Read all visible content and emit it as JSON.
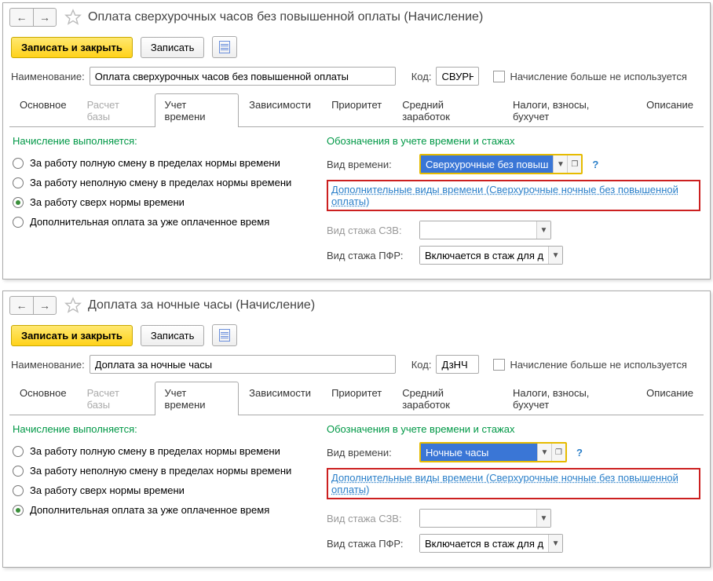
{
  "windows": [
    {
      "title": "Оплата сверхурочных часов без повышенной оплаты (Начисление)",
      "toolbar": {
        "primary": "Записать и закрыть",
        "write": "Записать"
      },
      "nameLabel": "Наименование:",
      "nameVal": "Оплата сверхурочных часов без повышенной оплаты",
      "codeLabel": "Код:",
      "codeVal": "СВУРН",
      "unusedLabel": "Начисление больше не используется",
      "tabs": {
        "main": "Основное",
        "base": "Расчет базы",
        "time": "Учет времени",
        "dep": "Зависимости",
        "prio": "Приоритет",
        "avg": "Средний заработок",
        "tax": "Налоги, взносы, бухучет",
        "desc": "Описание"
      },
      "leftHead": "Начисление выполняется:",
      "radios": {
        "r1": "За работу полную смену в пределах нормы времени",
        "r2": "За работу неполную смену в пределах нормы времени",
        "r3": "За работу сверх нормы времени",
        "r4": "Дополнительная оплата за уже оплаченное время"
      },
      "radioSel": "r3",
      "rightHead": "Обозначения в учете времени и стажах",
      "timeTypeLabel": "Вид времени:",
      "timeTypeVal": "Сверхурочные без повыш",
      "extraLink": "Дополнительные виды времени (Сверхурочные ночные без повышенной оплаты)",
      "szvLabel": "Вид стажа СЗВ:",
      "szvVal": "",
      "pfrLabel": "Вид стажа ПФР:",
      "pfrVal": "Включается в стаж для д"
    },
    {
      "title": "Доплата за ночные часы (Начисление)",
      "toolbar": {
        "primary": "Записать и закрыть",
        "write": "Записать"
      },
      "nameLabel": "Наименование:",
      "nameVal": "Доплата за ночные часы",
      "codeLabel": "Код:",
      "codeVal": "ДзНЧ",
      "unusedLabel": "Начисление больше не используется",
      "tabs": {
        "main": "Основное",
        "base": "Расчет базы",
        "time": "Учет времени",
        "dep": "Зависимости",
        "prio": "Приоритет",
        "avg": "Средний заработок",
        "tax": "Налоги, взносы, бухучет",
        "desc": "Описание"
      },
      "leftHead": "Начисление выполняется:",
      "radios": {
        "r1": "За работу полную смену в пределах нормы времени",
        "r2": "За работу неполную смену в пределах нормы времени",
        "r3": "За работу сверх нормы времени",
        "r4": "Дополнительная оплата за уже оплаченное время"
      },
      "radioSel": "r4",
      "rightHead": "Обозначения в учете времени и стажах",
      "timeTypeLabel": "Вид времени:",
      "timeTypeVal": "Ночные часы",
      "extraLink": "Дополнительные виды времени (Сверхурочные ночные без повышенной оплаты)",
      "szvLabel": "Вид стажа СЗВ:",
      "szvVal": "",
      "pfrLabel": "Вид стажа ПФР:",
      "pfrVal": "Включается в стаж для д"
    }
  ],
  "help": "?"
}
